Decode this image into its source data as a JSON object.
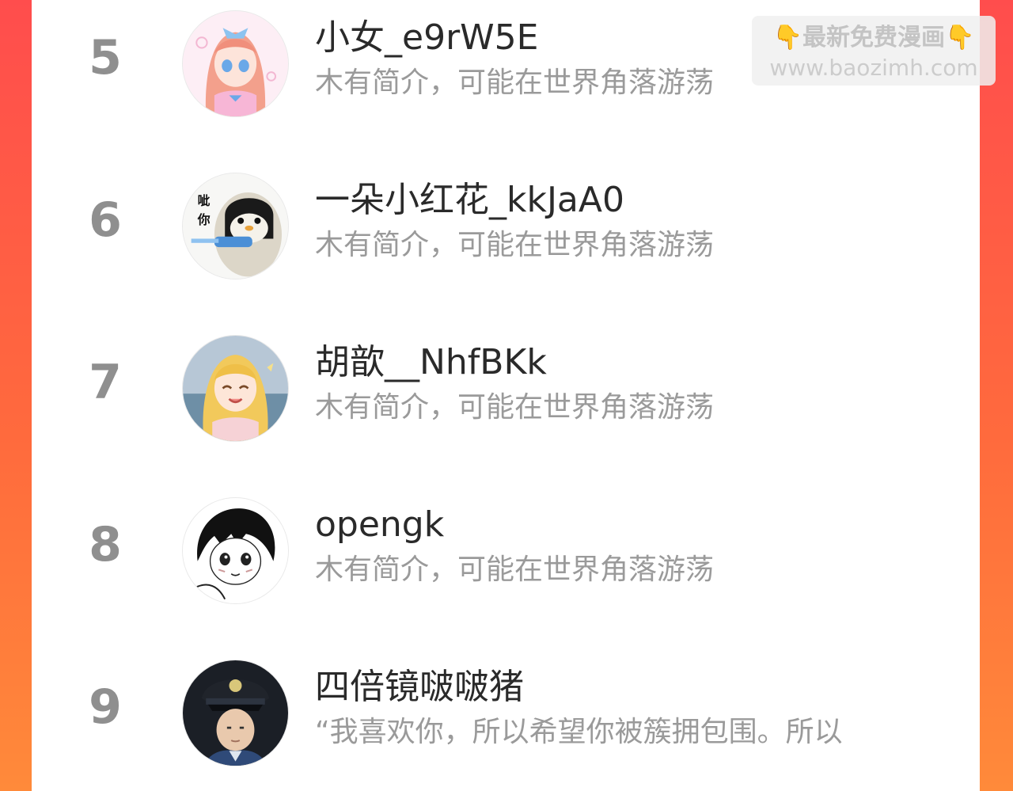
{
  "watermark": {
    "title": "最新免费漫画",
    "url": "www.baozimh.com",
    "hand_icon": "pointing-down-emoji"
  },
  "ranking": [
    {
      "rank": "5",
      "name": "小女_e9rW5E",
      "bio": "木有简介，可能在世界角落游荡",
      "avatar": "anime-girl-pink-avatar"
    },
    {
      "rank": "6",
      "name": "一朵小红花_kkJaA0",
      "bio": "木有简介，可能在世界角落游荡",
      "avatar": "penguin-meme-avatar",
      "avatar_text": "呲你"
    },
    {
      "rank": "7",
      "name": "胡歆__NhfBKk",
      "bio": "木有简介，可能在世界角落游荡",
      "avatar": "anime-girl-blonde-avatar"
    },
    {
      "rank": "8",
      "name": "opengk",
      "bio": "木有简介，可能在世界角落游荡",
      "avatar": "manga-boy-avatar"
    },
    {
      "rank": "9",
      "name": "四倍镜啵啵猪",
      "bio": "“我喜欢你，所以希望你被簇拥包围。所以",
      "avatar": "police-photo-avatar"
    }
  ],
  "colors": {
    "background_start": "#ff4d4d",
    "background_end": "#ff8a3a",
    "rank_number": "#8f8f8f",
    "name_text": "#2a2a2a",
    "bio_text": "#9a9a9a"
  }
}
